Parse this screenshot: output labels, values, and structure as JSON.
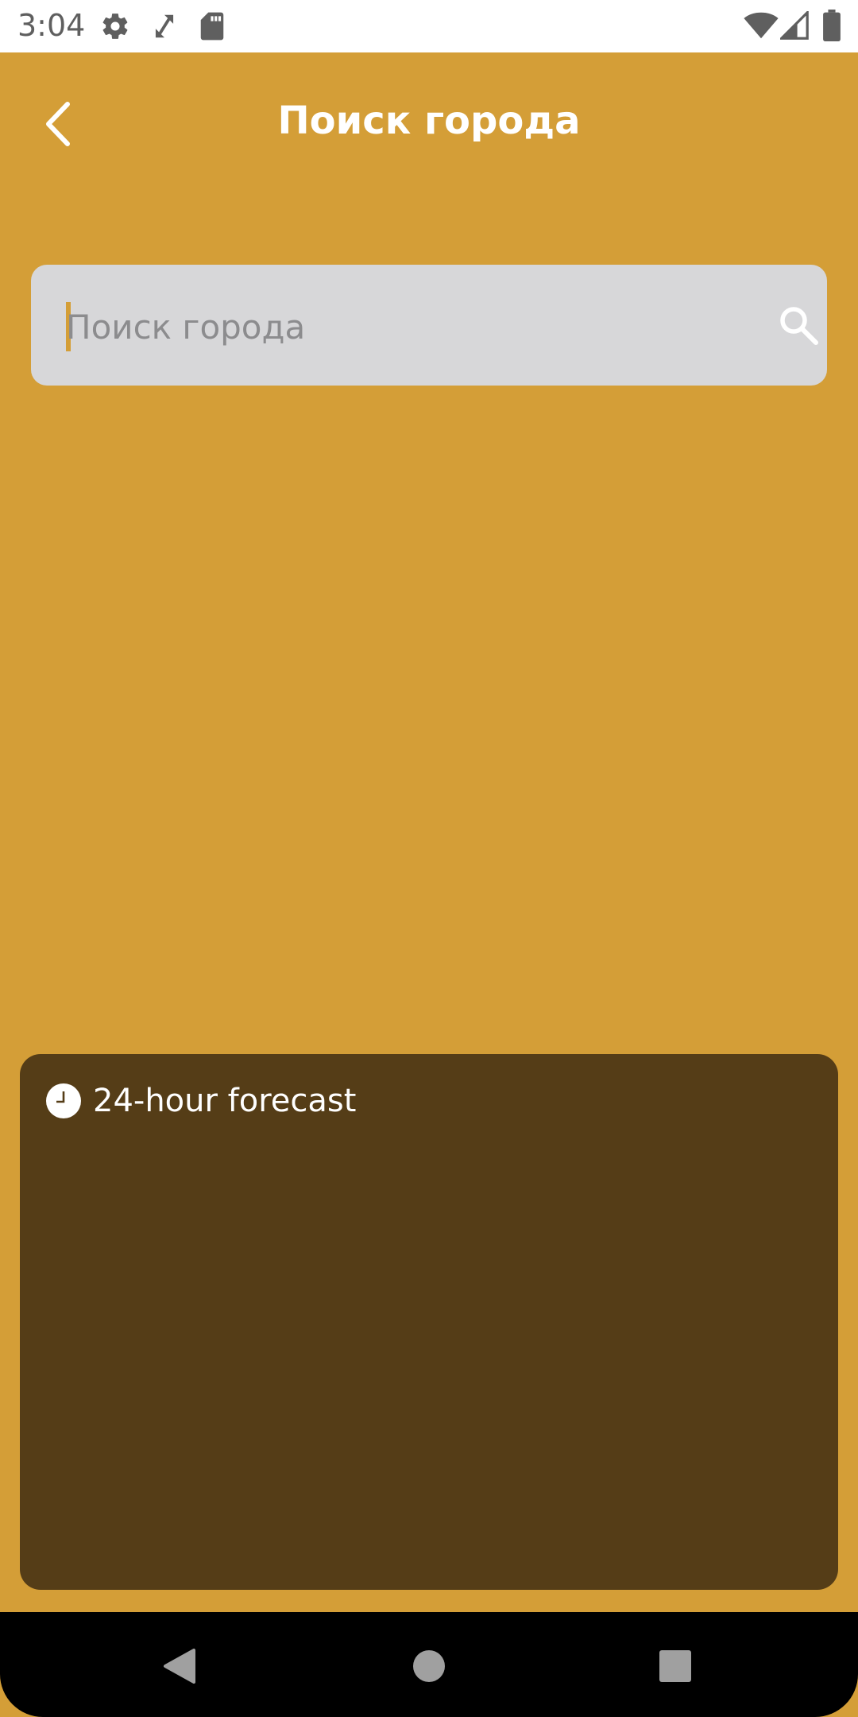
{
  "status_bar": {
    "time": "3:04",
    "icons": [
      "settings-icon",
      "rotate-icon",
      "sd-card-icon",
      "wifi-icon",
      "cellular-icon",
      "battery-icon"
    ]
  },
  "app_bar": {
    "back_icon": "chevron-left-icon",
    "title": "Поиск города"
  },
  "search": {
    "placeholder": "Поиск города",
    "value": "",
    "icon": "search-icon"
  },
  "forecast": {
    "icon": "clock-icon",
    "title": "24-hour forecast"
  },
  "nav_bar": {
    "buttons": [
      "back-triangle-icon",
      "home-circle-icon",
      "recents-square-icon"
    ]
  },
  "colors": {
    "background": "#D49E37",
    "card": "#553D17",
    "search_field": "#D7D7D9",
    "accent": "#D49E37"
  }
}
